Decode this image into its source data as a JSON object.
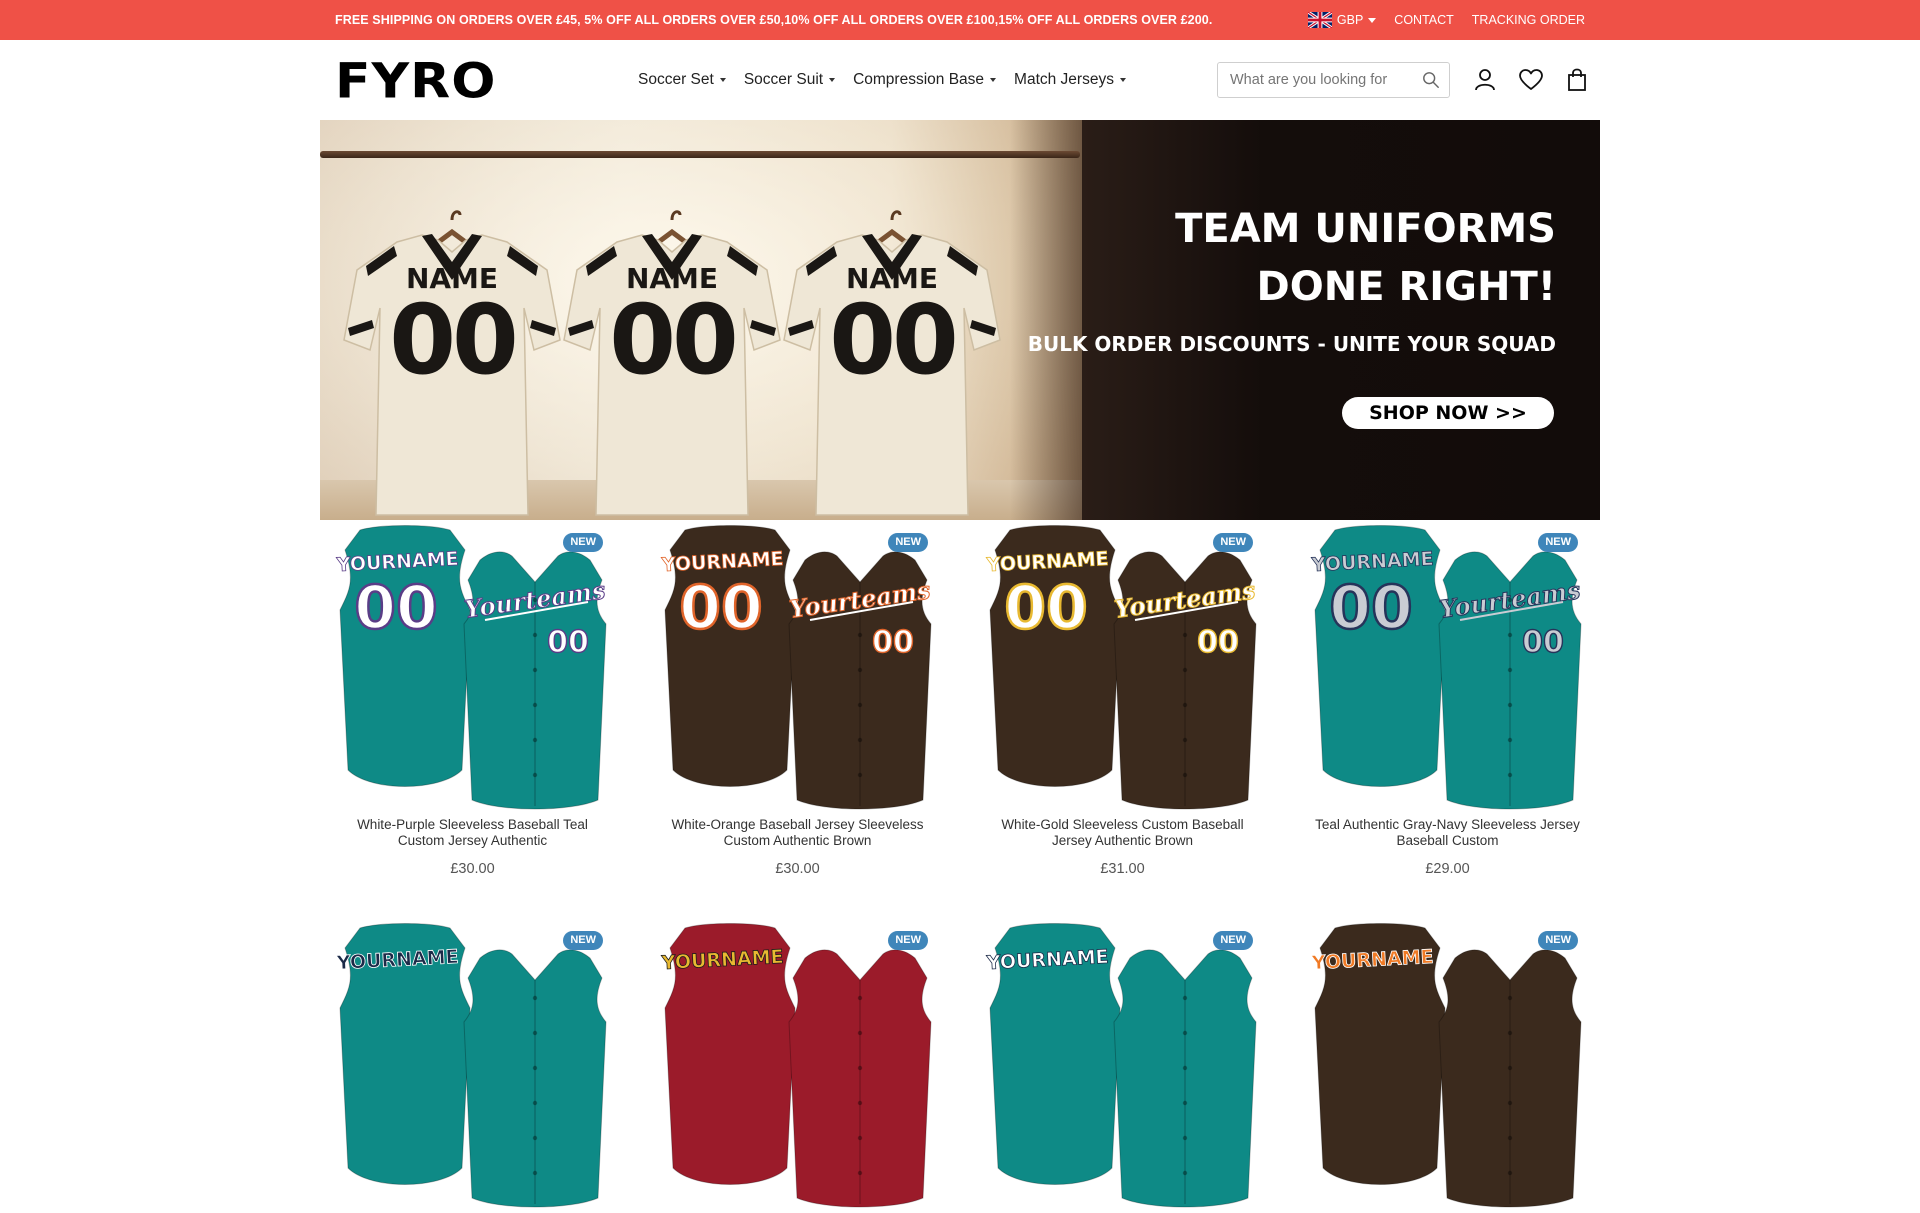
{
  "topbar": {
    "promo": "FREE SHIPPING ON ORDERS OVER £45, 5% OFF ALL ORDERS OVER £50,10% OFF ALL ORDERS OVER £100,15% OFF ALL ORDERS OVER £200.",
    "currency": "GBP",
    "contact": "CONTACT",
    "tracking": "TRACKING ORDER"
  },
  "header": {
    "logo": "FYRO",
    "nav": [
      {
        "label": "Soccer Set"
      },
      {
        "label": "Soccer Suit"
      },
      {
        "label": "Compression Base"
      },
      {
        "label": "Match Jerseys"
      }
    ],
    "search_placeholder": "What are you looking for"
  },
  "hero": {
    "title_line1": "TEAM UNIFORMS",
    "title_line2": "DONE RIGHT!",
    "subtitle": "BULK ORDER DISCOUNTS - UNITE YOUR SQUAD",
    "button": "SHOP NOW >>",
    "shirt_name": "NAME",
    "shirt_number": "00"
  },
  "products": [
    {
      "title": "White-Purple Sleeveless Baseball Teal Custom Jersey Authentic",
      "price": "£30.00",
      "badge": "NEW",
      "front_text": "YOURNAME",
      "back_text": "Yourteams",
      "number": "00",
      "body": "#0e8a86",
      "text": "#ffffff",
      "trim": "#5a3d87"
    },
    {
      "title": "White-Orange Baseball Jersey Sleeveless Custom Authentic Brown",
      "price": "£30.00",
      "badge": "NEW",
      "front_text": "YOURNAME",
      "back_text": "Yourteams",
      "number": "00",
      "body": "#3b2a1d",
      "text": "#ffffff",
      "trim": "#e0642a"
    },
    {
      "title": "White-Gold Sleeveless Custom Baseball Jersey Authentic Brown",
      "price": "£31.00",
      "badge": "NEW",
      "front_text": "YOURNAME",
      "back_text": "Yourteams",
      "number": "00",
      "body": "#3b2a1d",
      "text": "#ffffff",
      "trim": "#e8b931"
    },
    {
      "title": "Teal Authentic Gray-Navy Sleeveless Jersey Baseball Custom",
      "price": "£29.00",
      "badge": "NEW",
      "front_text": "YOURNAME",
      "back_text": "Yourteams",
      "number": "00",
      "body": "#0e8a86",
      "text": "#c9ccd3",
      "trim": "#26345a"
    },
    {
      "badge": "NEW",
      "front_text": "YOURNAME",
      "body": "#0e8a86",
      "text": "#1c2a48",
      "trim": "#ffffff"
    },
    {
      "badge": "NEW",
      "front_text": "YOURNAME",
      "body": "#9b1b2a",
      "text": "#e8b931",
      "trim": "#1c1c1c"
    },
    {
      "badge": "NEW",
      "front_text": "YOURNAME",
      "body": "#0e8a86",
      "text": "#ffffff",
      "trim": "#1c2a48"
    },
    {
      "badge": "NEW",
      "front_text": "YOURNAME",
      "body": "#3b2a1d",
      "text": "#f07a25",
      "trim": "#ffffff"
    }
  ]
}
